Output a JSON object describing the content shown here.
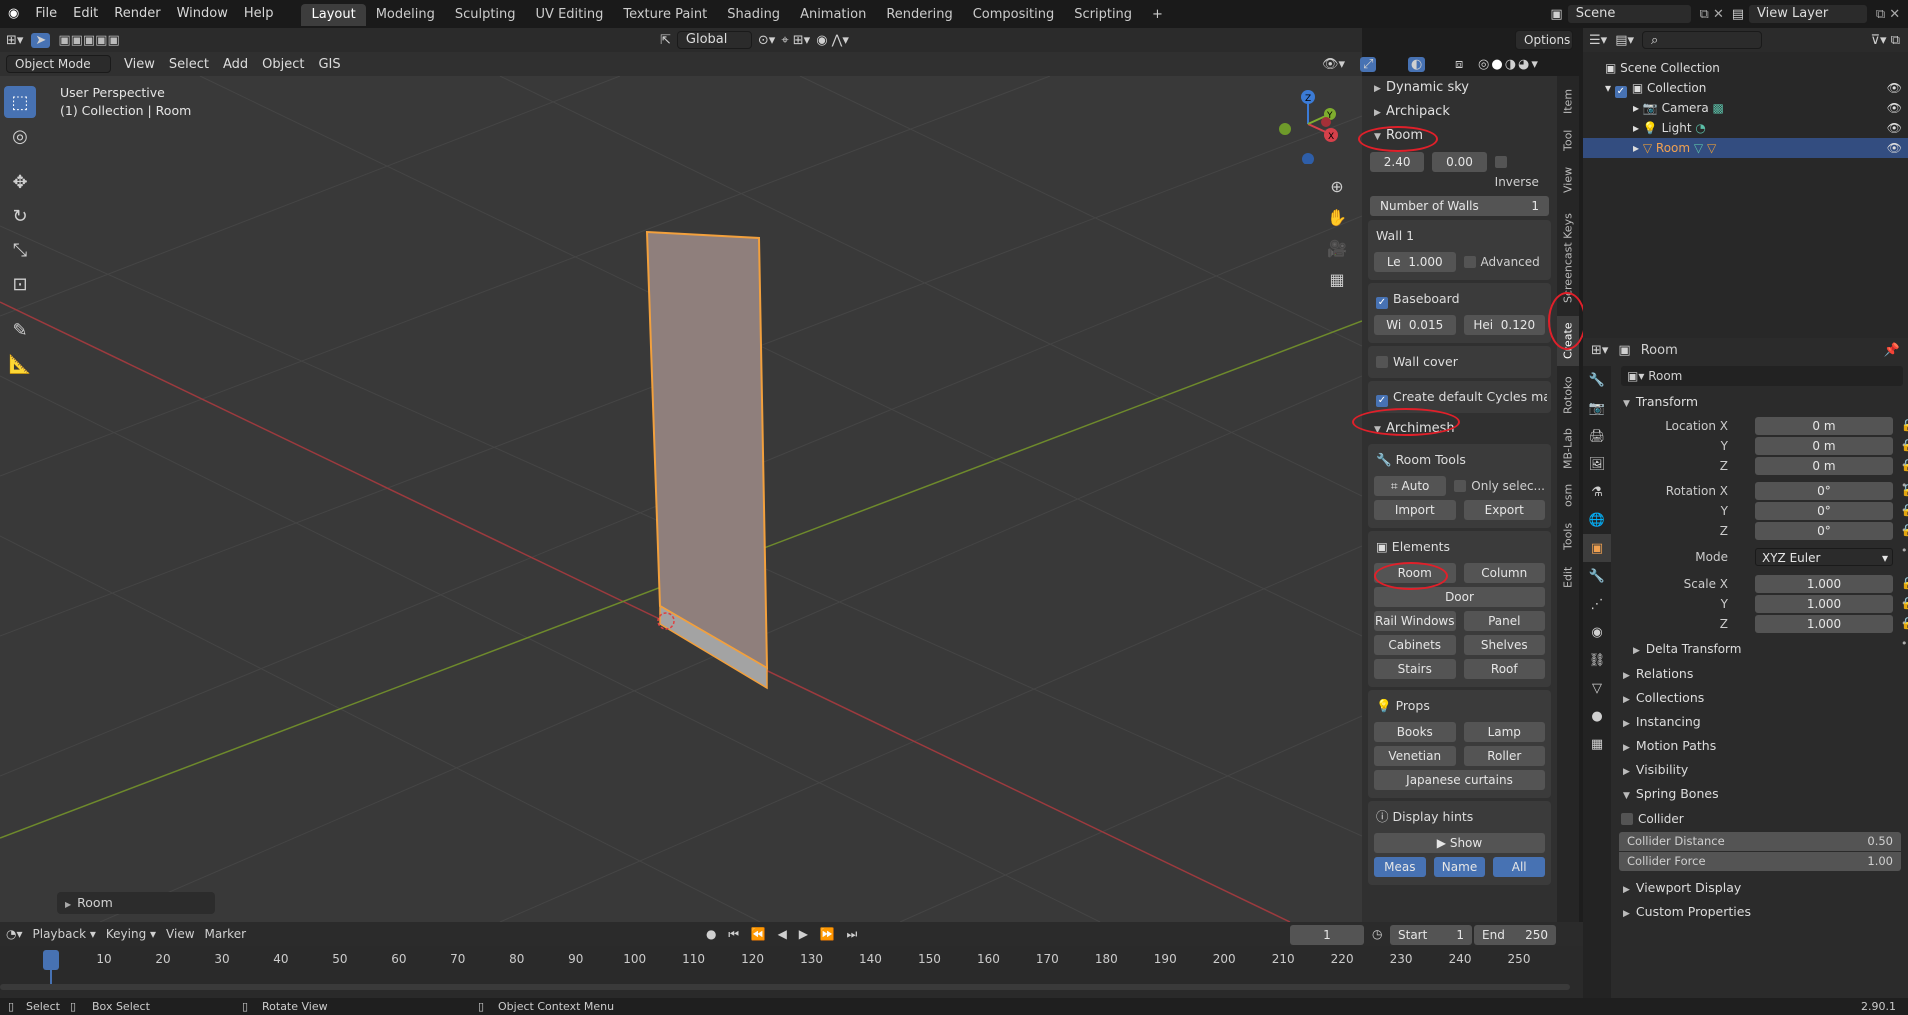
{
  "app": {
    "version": "2.90.1"
  },
  "topmenu": [
    "File",
    "Edit",
    "Render",
    "Window",
    "Help"
  ],
  "workspaces": [
    "Layout",
    "Modeling",
    "Sculpting",
    "UV Editing",
    "Texture Paint",
    "Shading",
    "Animation",
    "Rendering",
    "Compositing",
    "Scripting"
  ],
  "scene": "Scene",
  "view_layer": "View Layer",
  "options": "Options",
  "transform_orientation": "Global",
  "vp_header": {
    "mode": "Object Mode",
    "menus": [
      "View",
      "Select",
      "Add",
      "Object",
      "GIS"
    ]
  },
  "viewport": {
    "line1": "User Perspective",
    "line2": "(1) Collection | Room",
    "last_op": "Room"
  },
  "gizmo": {
    "x": "X",
    "y": "Y",
    "z": "Z"
  },
  "npanel": {
    "collapsed": [
      "Dynamic sky",
      "Archipack"
    ],
    "room_title": "Room",
    "vals": [
      "2.40",
      "0.00"
    ],
    "inverse": "Inverse",
    "num_walls_label": "Number of Walls",
    "num_walls": "1",
    "wall_title": "Wall 1",
    "le": "Le",
    "le_val": "1.000",
    "advanced": "Advanced",
    "baseboard": "Baseboard",
    "wi": "Wi",
    "wi_val": "0.015",
    "hei": "Hei",
    "hei_val": "0.120",
    "wall_cover": "Wall cover",
    "cycles": "Create default Cycles materi...",
    "archimesh": "Archimesh",
    "room_tools": "Room Tools",
    "auto_holes": "Auto Holes",
    "only_sel": "Only selec...",
    "import": "Import",
    "export": "Export",
    "elements": "Elements",
    "el_buttons": [
      [
        "Room",
        "Column"
      ],
      [
        "Door"
      ],
      [
        "Rail Windows",
        "Panel Window"
      ],
      [
        "Cabinets",
        "Shelves"
      ],
      [
        "Stairs",
        "Roof"
      ]
    ],
    "props": "Props",
    "prop_buttons": [
      [
        "Books",
        "Lamp"
      ],
      [
        "Venetian blind",
        "Roller curtains"
      ],
      [
        "Japanese curtains"
      ]
    ],
    "display_hints": "Display hints",
    "show": "Show",
    "hint_btns": [
      "Meas",
      "Name",
      "All"
    ]
  },
  "vtabs": [
    "Item",
    "Tool",
    "View",
    "Screencast Keys",
    "Create",
    "Rotoko",
    "MB-Lab",
    "osm",
    "Tools",
    "Edit"
  ],
  "outliner": {
    "root": "Scene Collection",
    "collection": "Collection",
    "items": [
      "Camera",
      "Light",
      "Room"
    ]
  },
  "properties": {
    "header": "Room",
    "object_name": "Room",
    "transform": "Transform",
    "location": [
      [
        "Location X",
        "0 m"
      ],
      [
        "Y",
        "0 m"
      ],
      [
        "Z",
        "0 m"
      ]
    ],
    "rotation": [
      [
        "Rotation X",
        "0°"
      ],
      [
        "Y",
        "0°"
      ],
      [
        "Z",
        "0°"
      ]
    ],
    "mode_label": "Mode",
    "mode": "XYZ Euler",
    "scale": [
      [
        "Scale X",
        "1.000"
      ],
      [
        "Y",
        "1.000"
      ],
      [
        "Z",
        "1.000"
      ]
    ],
    "delta": "Delta Transform",
    "sections": [
      "Relations",
      "Collections",
      "Instancing",
      "Motion Paths",
      "Visibility"
    ],
    "spring": "Spring Bones",
    "collider": "Collider",
    "collider_distance": [
      "Collider Distance",
      "0.50"
    ],
    "collider_force": [
      "Collider Force",
      "1.00"
    ],
    "more": [
      "Viewport Display",
      "Custom Properties"
    ]
  },
  "timeline": {
    "menus": [
      "Playback",
      "Keying",
      "View",
      "Marker"
    ],
    "frame": "1",
    "start_label": "Start",
    "start": "1",
    "end_label": "End",
    "end": "250",
    "ticks": [
      "1",
      "10",
      "20",
      "30",
      "40",
      "50",
      "60",
      "70",
      "80",
      "90",
      "100",
      "110",
      "120",
      "130",
      "140",
      "150",
      "160",
      "170",
      "180",
      "190",
      "200",
      "210",
      "220",
      "230",
      "240",
      "250"
    ]
  },
  "status": {
    "select": "Select",
    "box": "Box Select",
    "rotate": "Rotate View",
    "context": "Object Context Menu"
  }
}
